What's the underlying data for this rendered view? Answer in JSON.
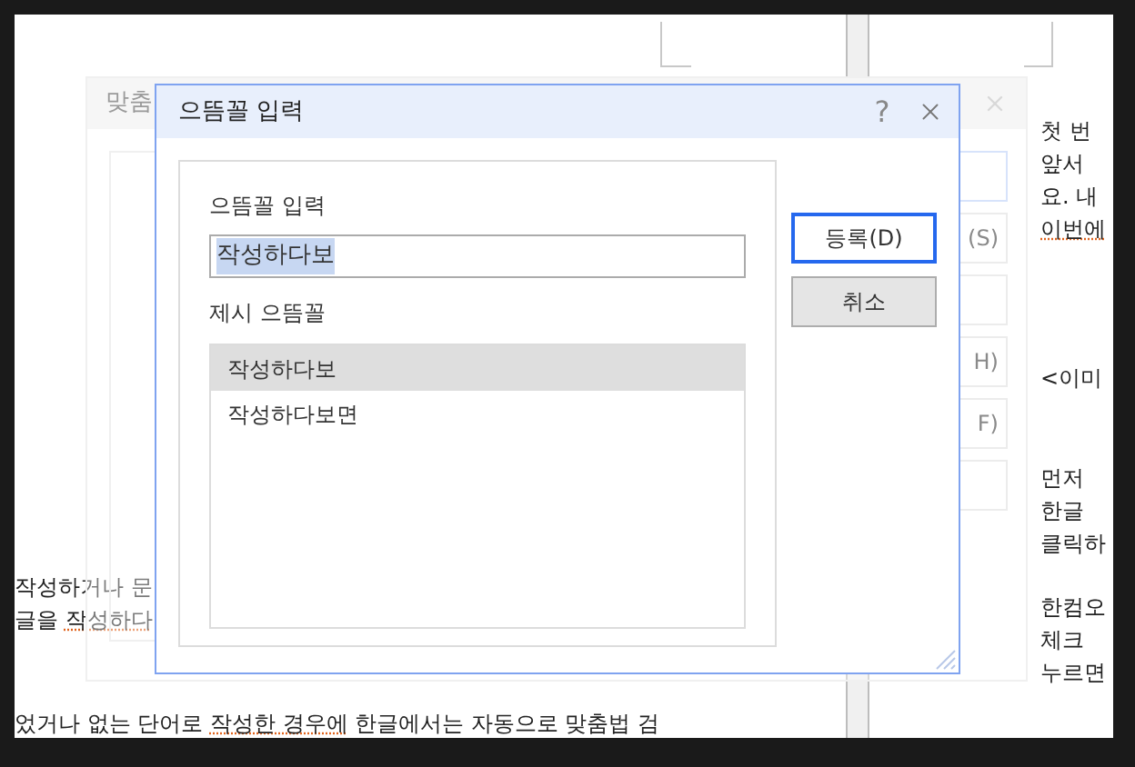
{
  "document": {
    "left_page": {
      "lines": [
        [
          {
            "text": "작성하거나 문",
            "misspelled": false
          }
        ],
        [
          {
            "text": "글을 ",
            "misspelled": false
          },
          {
            "text": "작성하다",
            "misspelled": true
          }
        ],
        [
          {
            "text": "었거나 없는 단어로 ",
            "misspelled": false
          },
          {
            "text": "작성한 경우에",
            "misspelled": true
          },
          {
            "text": " 한글에서는 자동으로 맞춤법 검",
            "misspelled": false
          }
        ]
      ]
    },
    "right_page": {
      "paragraphs": [
        [
          {
            "text": "첫 번",
            "misspelled": false
          },
          {
            "text": "앞서",
            "misspelled": false
          },
          {
            "text": "요. 내",
            "misspelled": false
          },
          {
            "text": "이번에",
            "misspelled": true
          }
        ],
        [
          {
            "text": "<이미",
            "misspelled": false
          }
        ],
        [
          {
            "text": "먼저",
            "misspelled": false
          },
          {
            "text": "한글",
            "misspelled": false
          },
          {
            "text": "클릭하",
            "misspelled": false
          }
        ],
        [
          {
            "text": "한컴오",
            "misspelled": false
          },
          {
            "text": "체크",
            "misspelled": false
          },
          {
            "text": "누르면",
            "misspelled": false
          }
        ]
      ]
    }
  },
  "background_dialog": {
    "title": "맞춤",
    "buttons": [
      "(S)",
      "H)",
      "F)"
    ]
  },
  "dialog": {
    "title": "으뜸꼴 입력",
    "help": "?",
    "field_label": "으뜸꼴 입력",
    "field_value": "작성하다보",
    "value_selected": true,
    "list_label": "제시 으뜸꼴",
    "items": [
      {
        "label": "작성하다보",
        "selected": true
      },
      {
        "label": "작성하다보면",
        "selected": false
      }
    ],
    "buttons": [
      {
        "label": "등록(D)",
        "default": true
      },
      {
        "label": "취소",
        "default": false
      }
    ]
  }
}
